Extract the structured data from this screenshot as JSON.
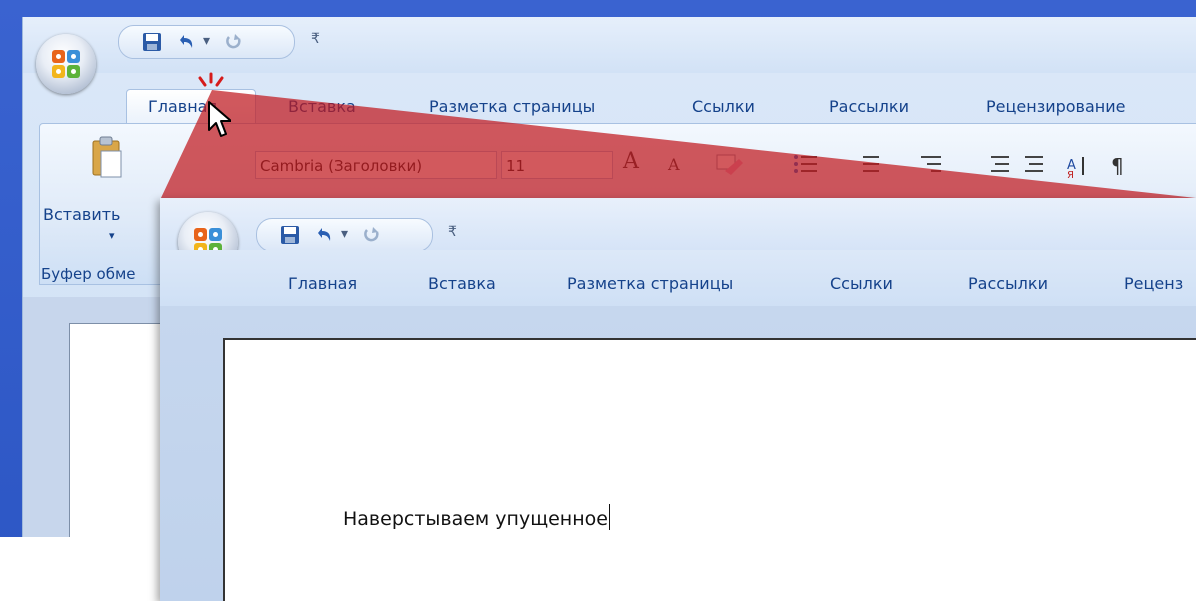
{
  "back_window": {
    "tabs": [
      "Главная",
      "Вставка",
      "Разметка страницы",
      "Ссылки",
      "Рассылки",
      "Рецензирование"
    ],
    "font_name": "Cambria (Заголовки)",
    "font_size": "11",
    "paste_label": "Вставить",
    "clipboard_group": "Буфер обме"
  },
  "front_window": {
    "tabs": [
      "Главная",
      "Вставка",
      "Разметка страницы",
      "Ссылки",
      "Рассылки",
      "Реценз"
    ],
    "document_text": "Наверстываем упущенное"
  },
  "icons": {
    "office_button": "office-logo-icon",
    "save": "save-icon",
    "undo": "undo-icon",
    "redo": "redo-icon",
    "customize": "customize-qat-icon",
    "cursor": "mouse-pointer-icon"
  },
  "colors": {
    "background": "#2f57c2",
    "highlight_triangle": "#c0191e",
    "tab_text": "#15428b"
  }
}
